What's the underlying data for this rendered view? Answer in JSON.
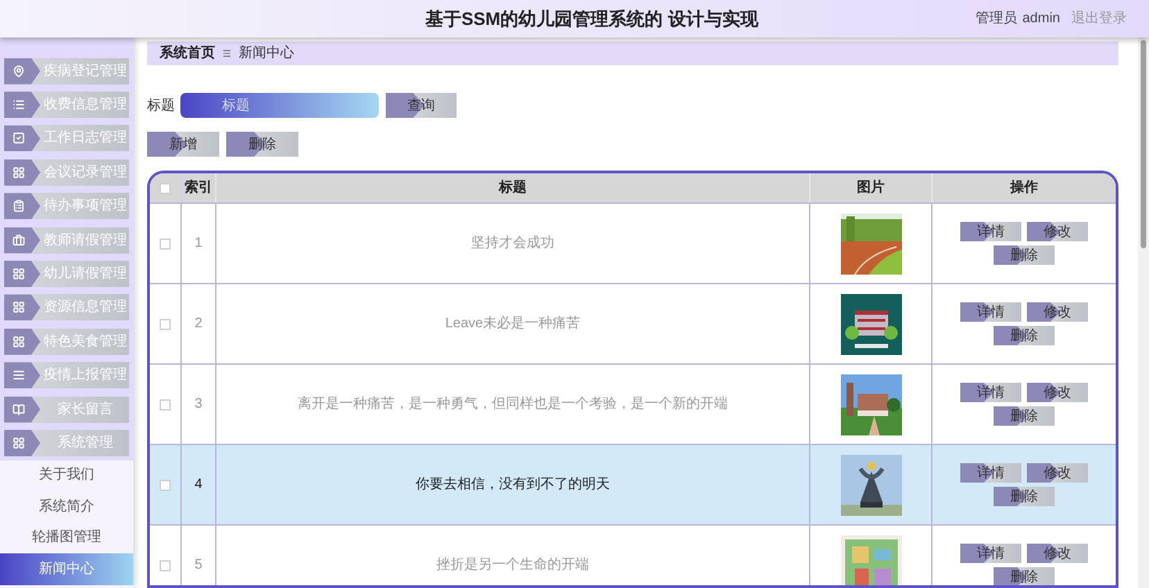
{
  "header": {
    "title": "基于SSM的幼儿园管理系统的 设计与实现",
    "user_role": "管理员",
    "username": "admin",
    "logout": "退出登录"
  },
  "sidebar": {
    "items": [
      {
        "label": "疾病登记管理"
      },
      {
        "label": "收费信息管理"
      },
      {
        "label": "工作日志管理"
      },
      {
        "label": "会议记录管理"
      },
      {
        "label": "待办事项管理"
      },
      {
        "label": "教师请假管理"
      },
      {
        "label": "幼儿请假管理"
      },
      {
        "label": "资源信息管理"
      },
      {
        "label": "特色美食管理"
      },
      {
        "label": "疫情上报管理"
      },
      {
        "label": "家长留言"
      },
      {
        "label": "系统管理",
        "children": [
          {
            "label": "关于我们",
            "selected": false
          },
          {
            "label": "系统简介",
            "selected": false
          },
          {
            "label": "轮播图管理",
            "selected": false
          },
          {
            "label": "新闻中心",
            "selected": true
          }
        ]
      }
    ]
  },
  "breadcrumb": [
    "系统首页",
    "新闻中心"
  ],
  "search": {
    "label": "标题",
    "placeholder": "标题",
    "button": "查询"
  },
  "toolbar": [
    "新增",
    "删除"
  ],
  "table": {
    "columns": [
      "索引",
      "标题",
      "图片",
      "操作"
    ],
    "all_checked": false,
    "rows": [
      {
        "index": "1",
        "title": "坚持才会成功",
        "image": {
          "kind": "picture"
        },
        "checked": false,
        "selected": false,
        "actions": [
          "详情",
          "修改",
          "删除"
        ]
      },
      {
        "index": "2",
        "title": "Leave未必是一种痛苦",
        "image": {
          "kind": "picture"
        },
        "checked": false,
        "selected": false,
        "actions": [
          "详情",
          "修改",
          "删除"
        ]
      },
      {
        "index": "3",
        "title": "离开是一种痛苦，是一种勇气，但同样也是一个考验，是一个新的开端",
        "image": {
          "kind": "picture"
        },
        "checked": false,
        "selected": false,
        "actions": [
          "详情",
          "修改",
          "删除"
        ]
      },
      {
        "index": "4",
        "title": "你要去相信，没有到不了的明天",
        "image": {
          "kind": "picture"
        },
        "checked": false,
        "selected": true,
        "actions": [
          "详情",
          "修改",
          "删除"
        ]
      },
      {
        "index": "5",
        "title": "挫折是另一个生命的开端",
        "image": {
          "kind": "picture"
        },
        "checked": false,
        "selected": false,
        "actions": [
          "详情",
          "修改",
          "删除"
        ]
      }
    ]
  }
}
